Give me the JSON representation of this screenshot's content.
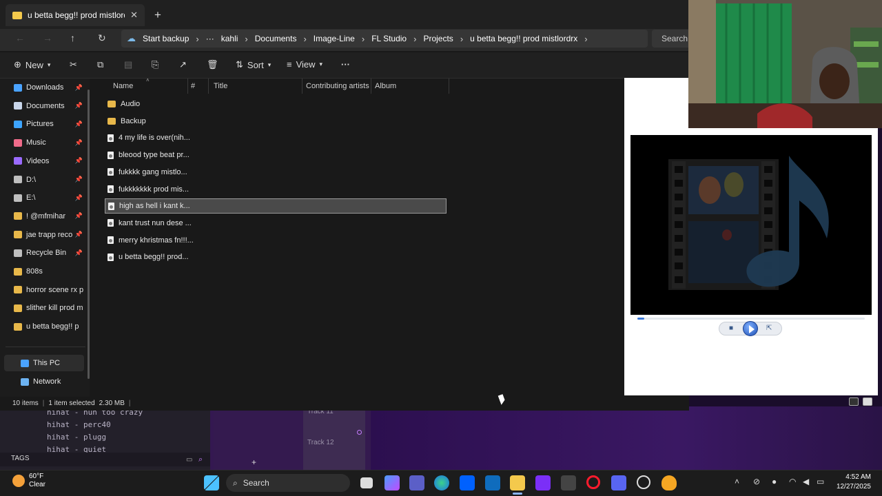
{
  "fl_studio": {
    "browser_items": [
      "hihat - nun too crazy",
      "hihat - perc40",
      "hihat - plugg",
      "hihat - quiet"
    ],
    "tags_label": "TAGS",
    "tracks": [
      "Track 11",
      "Track 12"
    ]
  },
  "explorer": {
    "tab_title": "u betta begg!! prod mistlordrx",
    "breadcrumb": [
      "Start backup",
      "kahli",
      "Documents",
      "Image-Line",
      "FL Studio",
      "Projects",
      "u betta begg!! prod mistlordrx"
    ],
    "search_placeholder": "Search",
    "toolbar": {
      "new": "New",
      "sort": "Sort",
      "view": "View"
    },
    "sidebar": [
      {
        "label": "Downloads",
        "icon": "download-icon",
        "color": "#4aa3ff",
        "pinned": true
      },
      {
        "label": "Documents",
        "icon": "document-icon",
        "color": "#c9d6ea",
        "pinned": true
      },
      {
        "label": "Pictures",
        "icon": "pictures-icon",
        "color": "#3da5ff",
        "pinned": true
      },
      {
        "label": "Music",
        "icon": "music-icon",
        "color": "#f06b8a",
        "pinned": true
      },
      {
        "label": "Videos",
        "icon": "videos-icon",
        "color": "#9b6bff",
        "pinned": true
      },
      {
        "label": "D:\\",
        "icon": "drive-icon",
        "color": "#bfbfbf",
        "pinned": true
      },
      {
        "label": "E:\\",
        "icon": "drive-icon",
        "color": "#bfbfbf",
        "pinned": true
      },
      {
        "label": "!  @mfmihar",
        "icon": "folder-icon",
        "color": "#e8b84a",
        "pinned": true
      },
      {
        "label": "jae trapp reco",
        "icon": "folder-icon",
        "color": "#e8b84a",
        "pinned": true
      },
      {
        "label": "Recycle Bin",
        "icon": "recycle-bin-icon",
        "color": "#bfbfbf",
        "pinned": true
      },
      {
        "label": "808s",
        "icon": "folder-icon",
        "color": "#e8b84a",
        "pinned": false
      },
      {
        "label": "horror scene rx p",
        "icon": "folder-icon",
        "color": "#e8b84a",
        "pinned": false
      },
      {
        "label": "slither kill prod m",
        "icon": "folder-icon",
        "color": "#e8b84a",
        "pinned": false
      },
      {
        "label": "u betta begg!! p",
        "icon": "folder-icon",
        "color": "#e8b84a",
        "pinned": false
      }
    ],
    "bottom_nav": [
      {
        "label": "This PC",
        "icon": "pc-icon"
      },
      {
        "label": "Network",
        "icon": "network-icon"
      }
    ],
    "columns": [
      "Name",
      "#",
      "Title",
      "Contributing artists",
      "Album"
    ],
    "files": [
      {
        "name": "Audio",
        "type": "folder"
      },
      {
        "name": "Backup",
        "type": "folder"
      },
      {
        "name": "4 my life is over(nih...",
        "type": "flp"
      },
      {
        "name": "bleood type beat pr...",
        "type": "flp"
      },
      {
        "name": "fukkkk gang mistlo...",
        "type": "flp"
      },
      {
        "name": "fukkkkkkk prod mis...",
        "type": "flp"
      },
      {
        "name": "high as hell i kant k...",
        "type": "flp",
        "selected": true
      },
      {
        "name": "kant trust nun dese ...",
        "type": "flp"
      },
      {
        "name": "merry khristmas fn!!!...",
        "type": "flp"
      },
      {
        "name": "u betta begg!! prod...",
        "type": "flp"
      }
    ],
    "status": {
      "items": "10 items",
      "selected": "1 item selected",
      "size": "2.30 MB"
    }
  },
  "taskbar": {
    "weather_temp": "60°F",
    "weather_desc": "Clear",
    "search_label": "Search",
    "time": "4:52 AM",
    "date": "12/27/2025"
  },
  "colors": {
    "accent": "#3a78d8",
    "folder": "#e8b84a",
    "fl_purple": "#3b1a5c"
  }
}
